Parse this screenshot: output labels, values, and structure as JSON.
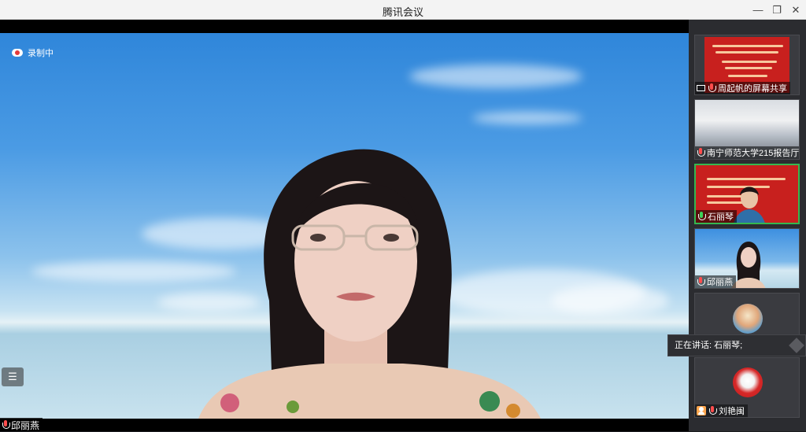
{
  "window": {
    "title": "腾讯会议",
    "minimize_icon": "minimize-icon",
    "restore_icon": "restore-icon",
    "close_icon": "close-icon"
  },
  "main": {
    "recording_label": "录制中",
    "speaker_name": "邱丽燕",
    "list_icon": "list-icon"
  },
  "sidebar": {
    "tiles": [
      {
        "label": "周起帆的屏幕共享",
        "icon": "screen-share-icon"
      },
      {
        "label": "南宁师范大学215报告厅",
        "icon": "mic-muted-icon"
      },
      {
        "label": "石丽琴",
        "icon": "mic-active-icon"
      },
      {
        "label": "邱丽燕",
        "icon": "mic-muted-icon"
      },
      {
        "label": "",
        "icon": "avatar"
      },
      {
        "label": "刘艳闽",
        "icon": "mic-muted-icon"
      }
    ]
  },
  "tooltip": {
    "speaking_text": "正在讲话: 石丽琴;"
  },
  "colors": {
    "active_border": "#35b74f",
    "muted_mic": "#ff4d4d",
    "slide_red": "#c8201e"
  }
}
